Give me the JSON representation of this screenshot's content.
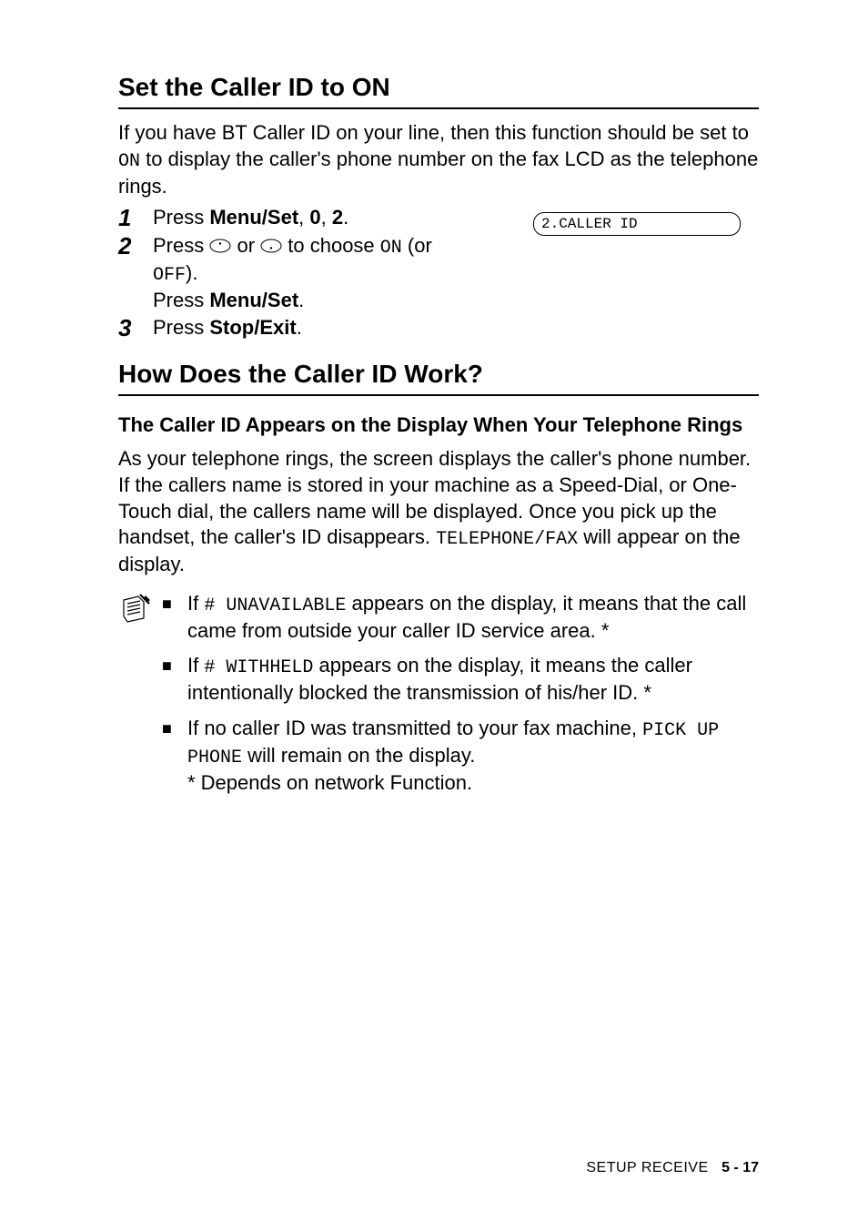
{
  "heading1": "Set the Caller ID to ON",
  "intro_parts": {
    "p1": "If you have BT Caller ID on your line, then this function should be set to ",
    "on": "ON",
    "p2": " to display the caller's phone number on the fax LCD as the telephone rings."
  },
  "lcd_text": "2.CALLER ID",
  "steps": {
    "s1": {
      "num": "1",
      "pre": "Press ",
      "b1": "Menu/Set",
      "sep1": ", ",
      "b2": "0",
      "sep2": ", ",
      "b3": "2",
      "end": "."
    },
    "s2": {
      "num": "2",
      "pre": "Press ",
      "mid": " or ",
      "post": " to choose ",
      "on": "ON",
      "paren": " (or ",
      "off": "OFF",
      "close": ").",
      "line2_pre": "Press ",
      "line2_b": "Menu/Set",
      "line2_end": "."
    },
    "s3": {
      "num": "3",
      "pre": "Press ",
      "b1": "Stop/Exit",
      "end": "."
    }
  },
  "heading2": "How Does the Caller ID Work?",
  "subhead": "The Caller ID Appears on the Display When Your Telephone Rings",
  "para2_parts": {
    "p1": "As your telephone rings, the screen displays the caller's phone number. If the callers name is stored in your machine as a Speed-Dial, or One-Touch dial, the callers name will be displayed. Once you pick up the handset, the caller's ID disappears. ",
    "mono": "TELEPHONE/FAX",
    "p2": " will appear on the display."
  },
  "notes": {
    "n1": {
      "pre": "If ",
      "code": "# UNAVAILABLE",
      "post": " appears on the display, it means that the call came from outside your caller ID service area. *"
    },
    "n2": {
      "pre": "If ",
      "code": "# WITHHELD",
      "post": " appears on the display, it means the caller intentionally blocked the transmission of his/her ID. *"
    },
    "n3": {
      "pre": "If no caller ID was transmitted to your fax machine, ",
      "code": "PICK UP PHONE",
      "post": " will remain on the display."
    },
    "footnote": "* Depends on network Function."
  },
  "footer": {
    "section": "SETUP RECEIVE",
    "page": "5 - 17"
  }
}
